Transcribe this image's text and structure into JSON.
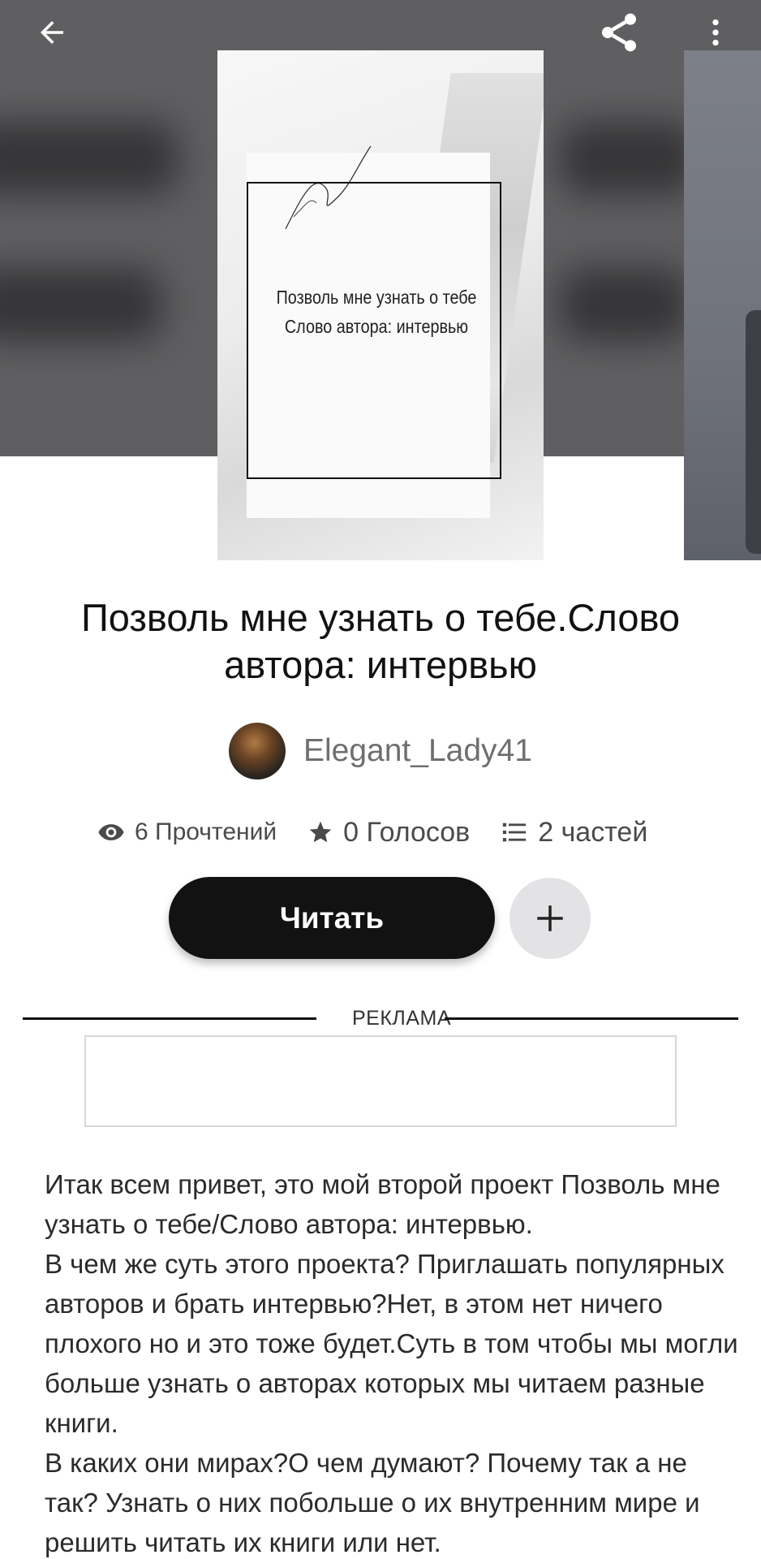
{
  "header": {
    "back_icon": "arrow-left-icon",
    "share_icon": "share-icon",
    "more_icon": "more-vertical-icon"
  },
  "cover": {
    "line1": "Позволь мне узнать о тебе",
    "line2": "Слово автора: интервью"
  },
  "story": {
    "title": "Позволь мне узнать о тебе.Слово автора: интервью",
    "author": "Elegant_Lady41"
  },
  "stats": {
    "reads": "6 Прочтений",
    "votes": "0 Голосов",
    "parts": "2 частей"
  },
  "actions": {
    "read_label": "Читать",
    "add_icon": "plus-icon"
  },
  "ad": {
    "label": "РЕКЛАМА"
  },
  "description": {
    "p1": "Итак всем привет, это мой второй проект Позволь мне узнать о тебе/Слово автора: интервью.",
    "p2": "В чем же суть этого проекта? Приглашать популярных авторов и брать интервью?Нет, в этом нет ничего плохого но и это тоже будет.Суть в том чтобы мы могли больше узнать о авторах которых мы читаем разные книги.",
    "p3": "В каких они мирах?О чем думают? Почему так а не так? Узнать о них побольше о их внутренним мире и решить читать их книги или нет."
  },
  "colors": {
    "hero_bg": "#5f5f61",
    "read_button": "#121212",
    "add_button": "#e3e3e5",
    "text": "#111111",
    "muted_text": "#6f6f6f"
  }
}
